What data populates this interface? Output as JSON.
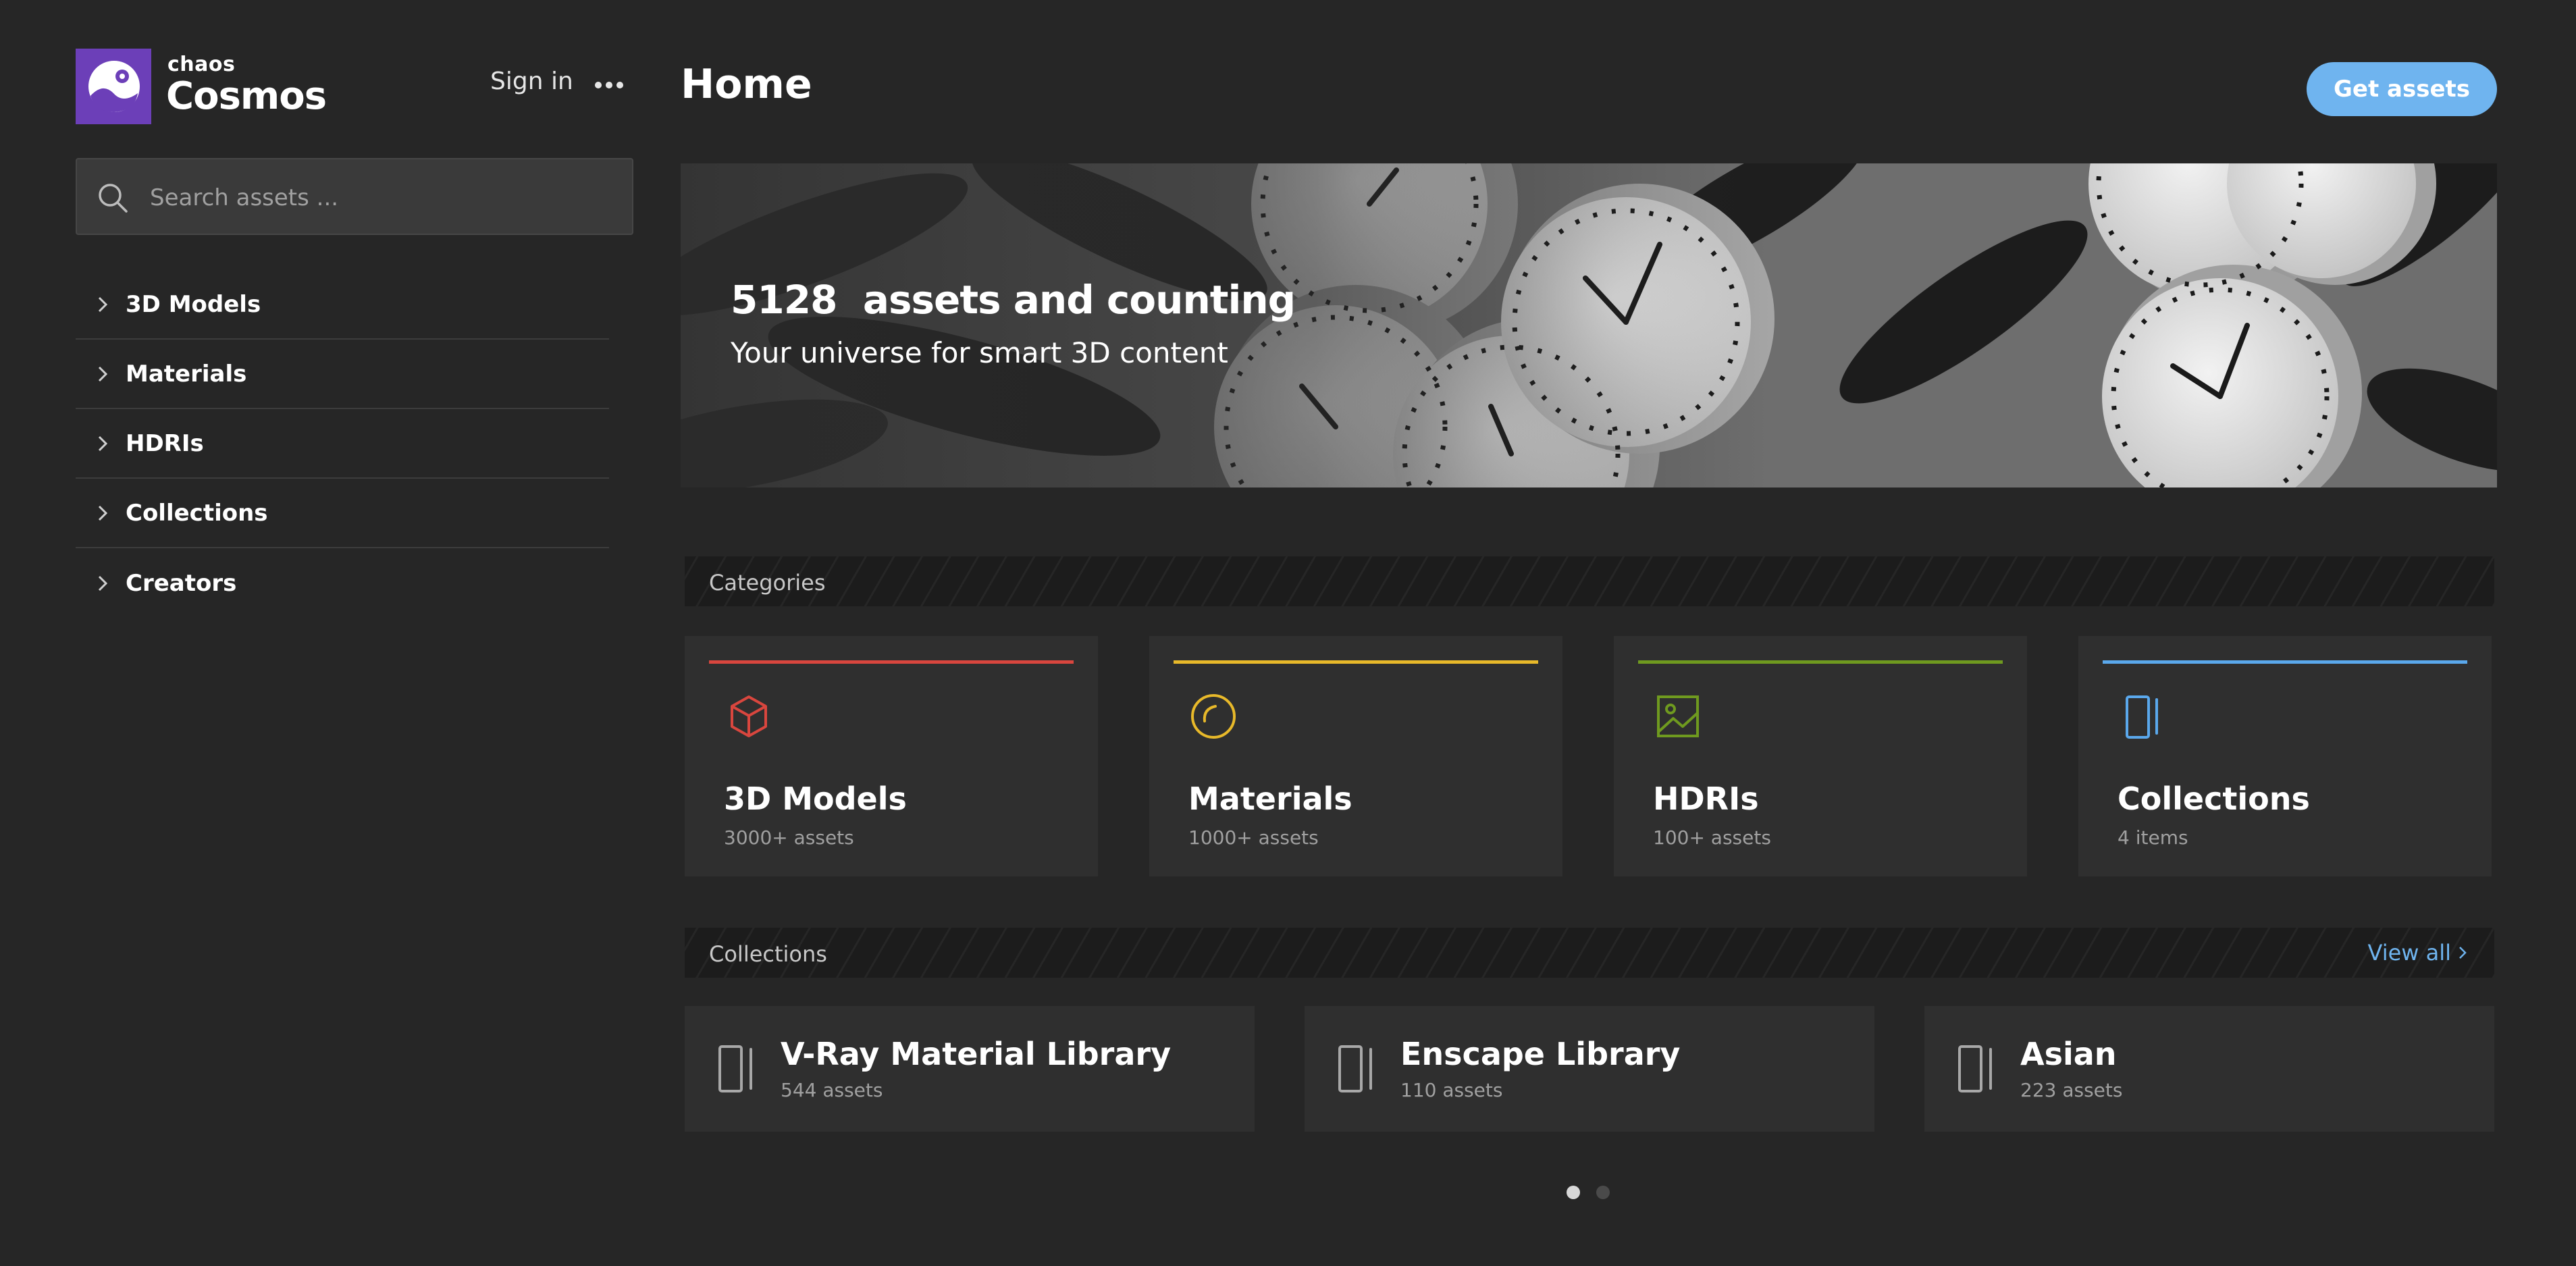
{
  "app": {
    "brand": "chaos",
    "product": "Cosmos"
  },
  "header": {
    "sign_in": "Sign in",
    "more": "more-options",
    "page_title": "Home",
    "get_assets": "Get assets"
  },
  "search": {
    "placeholder": "Search assets ...",
    "value": ""
  },
  "sidebar": {
    "items": [
      {
        "label": "3D Models"
      },
      {
        "label": "Materials"
      },
      {
        "label": "HDRIs"
      },
      {
        "label": "Collections"
      },
      {
        "label": "Creators"
      }
    ]
  },
  "hero": {
    "count": "5128",
    "count_suffix": "assets and counting",
    "subtitle": "Your universe for smart 3D content"
  },
  "categories": {
    "title": "Categories",
    "cards": [
      {
        "title": "3D Models",
        "sub": "3000+ assets",
        "color": "#d9463e",
        "icon": "cube-icon"
      },
      {
        "title": "Materials",
        "sub": "1000+ assets",
        "color": "#e8b92a",
        "icon": "material-sphere-icon"
      },
      {
        "title": "HDRIs",
        "sub": "100+ assets",
        "color": "#6f9a1f",
        "icon": "image-icon"
      },
      {
        "title": "Collections",
        "sub": "4 items",
        "color": "#5aa8ec",
        "icon": "collection-icon"
      }
    ]
  },
  "collections": {
    "title": "Collections",
    "view_all": "View all",
    "cards": [
      {
        "title": "V-Ray Material Library",
        "sub": "544 assets"
      },
      {
        "title": "Enscape Library",
        "sub": "110 assets"
      },
      {
        "title": "Asian",
        "sub": "223 assets"
      }
    ]
  },
  "pagination": {
    "pages": 2,
    "active": 1
  },
  "colors": {
    "background": "#262626",
    "card": "#2f2f2f",
    "accent": "#6fb4ef",
    "logo": "#6c3fb8"
  }
}
